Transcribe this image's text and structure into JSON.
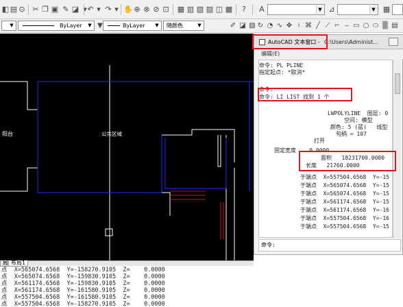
{
  "toolbar": {
    "top_combo_value": "",
    "props": {
      "color": "ByLayer",
      "linetype": "ByLayer",
      "lineweight": "随颜色"
    }
  },
  "drawing": {
    "labels": {
      "balcony": "阳台",
      "public_area": "公共区域"
    },
    "tabs": [
      "局",
      "布局1"
    ]
  },
  "history": [
    "点  X=565074.6568  Y=-158270.9105  Z=    0.0000",
    "点  X=565074.6568  Y=-159830.9105  Z=    0.0000",
    "点  X=561174.6568  Y=-159830.9105  Z=    0.0000",
    "点  X=561174.6568  Y=-161580.9105  Z=    0.0000",
    "点  X=557504.6568  Y=-161580.9105  Z=    0.0000",
    "点  X=557504.6568  Y=-158270.9105  Z=    0.0000"
  ],
  "text_window": {
    "title": "AutoCAD 文本窗口 - C:\\Users\\Administ...",
    "title_app": "AutoCAD 文本窗口 -",
    "title_path": "C:\\Users\\Administ...",
    "menu_edit": "编辑(E)",
    "lines": {
      "l1": "命令: PL PLINE",
      "l2": "指定起点: *取消*",
      "l3": "命令:",
      "l4": "命令: LI LIST 找到 1 个",
      "l5": "LWPOLYLINE  图层: 0",
      "l6": "空间: 模型",
      "l7": "颜色: 5 (蓝)   线型",
      "l8": "句柄 = 107",
      "l9": "打开",
      "l10": "固定宽度    0.0000",
      "l11": "面积   18231700.0000",
      "l12": "长度   21760.0000",
      "v": [
        "于端点  X=557504.6568  Y=-15",
        "于端点  X=565074.6568  Y=-15",
        "于端点  X=565074.6568  Y=-15",
        "于端点  X=561174.6568  Y=-15",
        "于端点  X=561174.6568  Y=-16",
        "于端点  X=557504.6568  Y=-16",
        "于端点  X=557504.6568  Y=-15"
      ]
    },
    "command_prompt": "命令:"
  },
  "colors": {
    "highlight_red": "#e0141b",
    "drawing_bg": "#000000",
    "blue_polyline": "#1f2fff"
  }
}
